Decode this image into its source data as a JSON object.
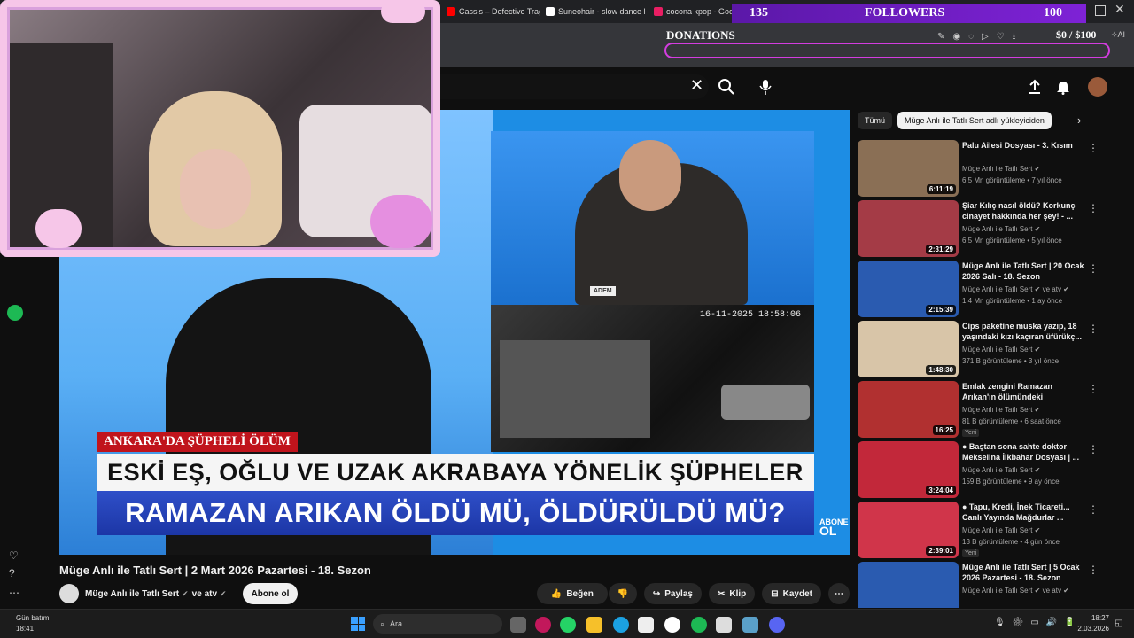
{
  "browser": {
    "tabs": [
      {
        "title": "Cassis – Defective Tragedy",
        "color": "#ff0000"
      },
      {
        "title": "Suneohair - slow dance l",
        "color": "#ffffff"
      },
      {
        "title": "cocona kpop - Googl",
        "color": "#e91e63"
      },
      {
        "title": "",
        "color": "#999"
      }
    ],
    "toolbar_icons": [
      "edit-icon",
      "camera-icon",
      "shield-icon",
      "play-icon",
      "heart-icon",
      "download-icon",
      "ai-icon"
    ]
  },
  "stream_overlay": {
    "followers_current": "135",
    "followers_label": "FOLLOWERS",
    "followers_goal": "100",
    "donations_label": "DONATIONS",
    "donations_current": "$0",
    "donations_goal": "/ $100"
  },
  "youtube": {
    "video_title": "Müge Anlı ile Tatlı Sert | 2 Mart 2026 Pazartesi - 18. Sezon",
    "channel": {
      "name": "Müge Anlı ile Tatlı Sert",
      "and": "ve atv",
      "subscribe": "Abone ol"
    },
    "actions": {
      "like": "Beğen",
      "share": "Paylaş",
      "clip": "Klip",
      "save": "Kaydet"
    },
    "player_content": {
      "tag": "ANKARA'DA ŞÜPHELİ ÖLÜM",
      "line1": "ESKİ EŞ, OĞLU VE UZAK AKRABAYA YÖNELİK ŞÜPHELER",
      "line2": "RAMAZAN ARIKAN ÖLDÜ MÜ, ÖLDÜRÜLDÜ MÜ?",
      "namecard": "ADEM",
      "cam_timestamp": "16-11-2025 18:58:06",
      "corner_top": "ABONE",
      "corner_bottom": "OL"
    },
    "chips": [
      {
        "label": "Tümü",
        "active": false
      },
      {
        "label": "Müge Anlı ile Tatlı Sert adlı yükleyiciden",
        "active": true
      }
    ],
    "related": [
      {
        "title": "Palu Ailesi Dosyası - 3. Kısım",
        "channel": "Müge Anlı ile Tatlı Sert ✔",
        "meta": "6,5 Mn görüntüleme • 7 yıl önce",
        "duration": "6:11:19",
        "thumb_color": "#8a6f55",
        "badge": ""
      },
      {
        "title": "Şiar Kılıç nasıl öldü? Korkunç cinayet hakkında her şey! - ...",
        "channel": "Müge Anlı ile Tatlı Sert ✔",
        "meta": "6,5 Mn görüntüleme • 5 yıl önce",
        "duration": "2:31:29",
        "thumb_color": "#a43b46",
        "badge": ""
      },
      {
        "title": "Müge Anlı ile Tatlı Sert | 20 Ocak 2026 Salı - 18. Sezon",
        "channel": "Müge Anlı ile Tatlı Sert ✔ ve atv ✔",
        "meta": "1,4 Mn görüntüleme • 1 ay önce",
        "duration": "2:15:39",
        "thumb_color": "#2a5bb0",
        "badge": ""
      },
      {
        "title": "Cips paketine muska yazıp, 18 yaşındaki kızı kaçıran üfürükç...",
        "channel": "Müge Anlı ile Tatlı Sert ✔",
        "meta": "371 B görüntüleme • 3 yıl önce",
        "duration": "1:48:30",
        "thumb_color": "#d8c5a8",
        "badge": ""
      },
      {
        "title": "Emlak zengini Ramazan Arıkan'ın ölümündeki şüpheler!...",
        "channel": "Müge Anlı ile Tatlı Sert ✔",
        "meta": "81 B görüntüleme • 6 saat önce",
        "duration": "16:25",
        "thumb_color": "#b13030",
        "badge": "Yeni"
      },
      {
        "title": "● Baştan sona sahte doktor Mekselina İlkbahar Dosyası | ...",
        "channel": "Müge Anlı ile Tatlı Sert ✔",
        "meta": "159 B görüntüleme • 9 ay önce",
        "duration": "3:24:04",
        "thumb_color": "#c2283a",
        "badge": ""
      },
      {
        "title": "● Tapu, Kredi, İnek Ticareti... Canlı Yayında Mağdurlar ...",
        "channel": "Müge Anlı ile Tatlı Sert ✔",
        "meta": "13 B görüntüleme • 4 gün önce",
        "duration": "2:39:01",
        "thumb_color": "#d0354a",
        "badge": "Yeni"
      },
      {
        "title": "Müge Anlı ile Tatlı Sert | 5 Ocak 2026 Pazartesi - 18. Sezon",
        "channel": "Müge Anlı ile Tatlı Sert ✔ ve atv ✔",
        "meta": "",
        "duration": "",
        "thumb_color": "#2a5bb0",
        "badge": ""
      }
    ]
  },
  "taskbar": {
    "weather_label": "Gün batımı",
    "weather_time": "18:41",
    "search_placeholder": "Ara",
    "clock_time": "18:27",
    "clock_date": "2.03.2026"
  }
}
